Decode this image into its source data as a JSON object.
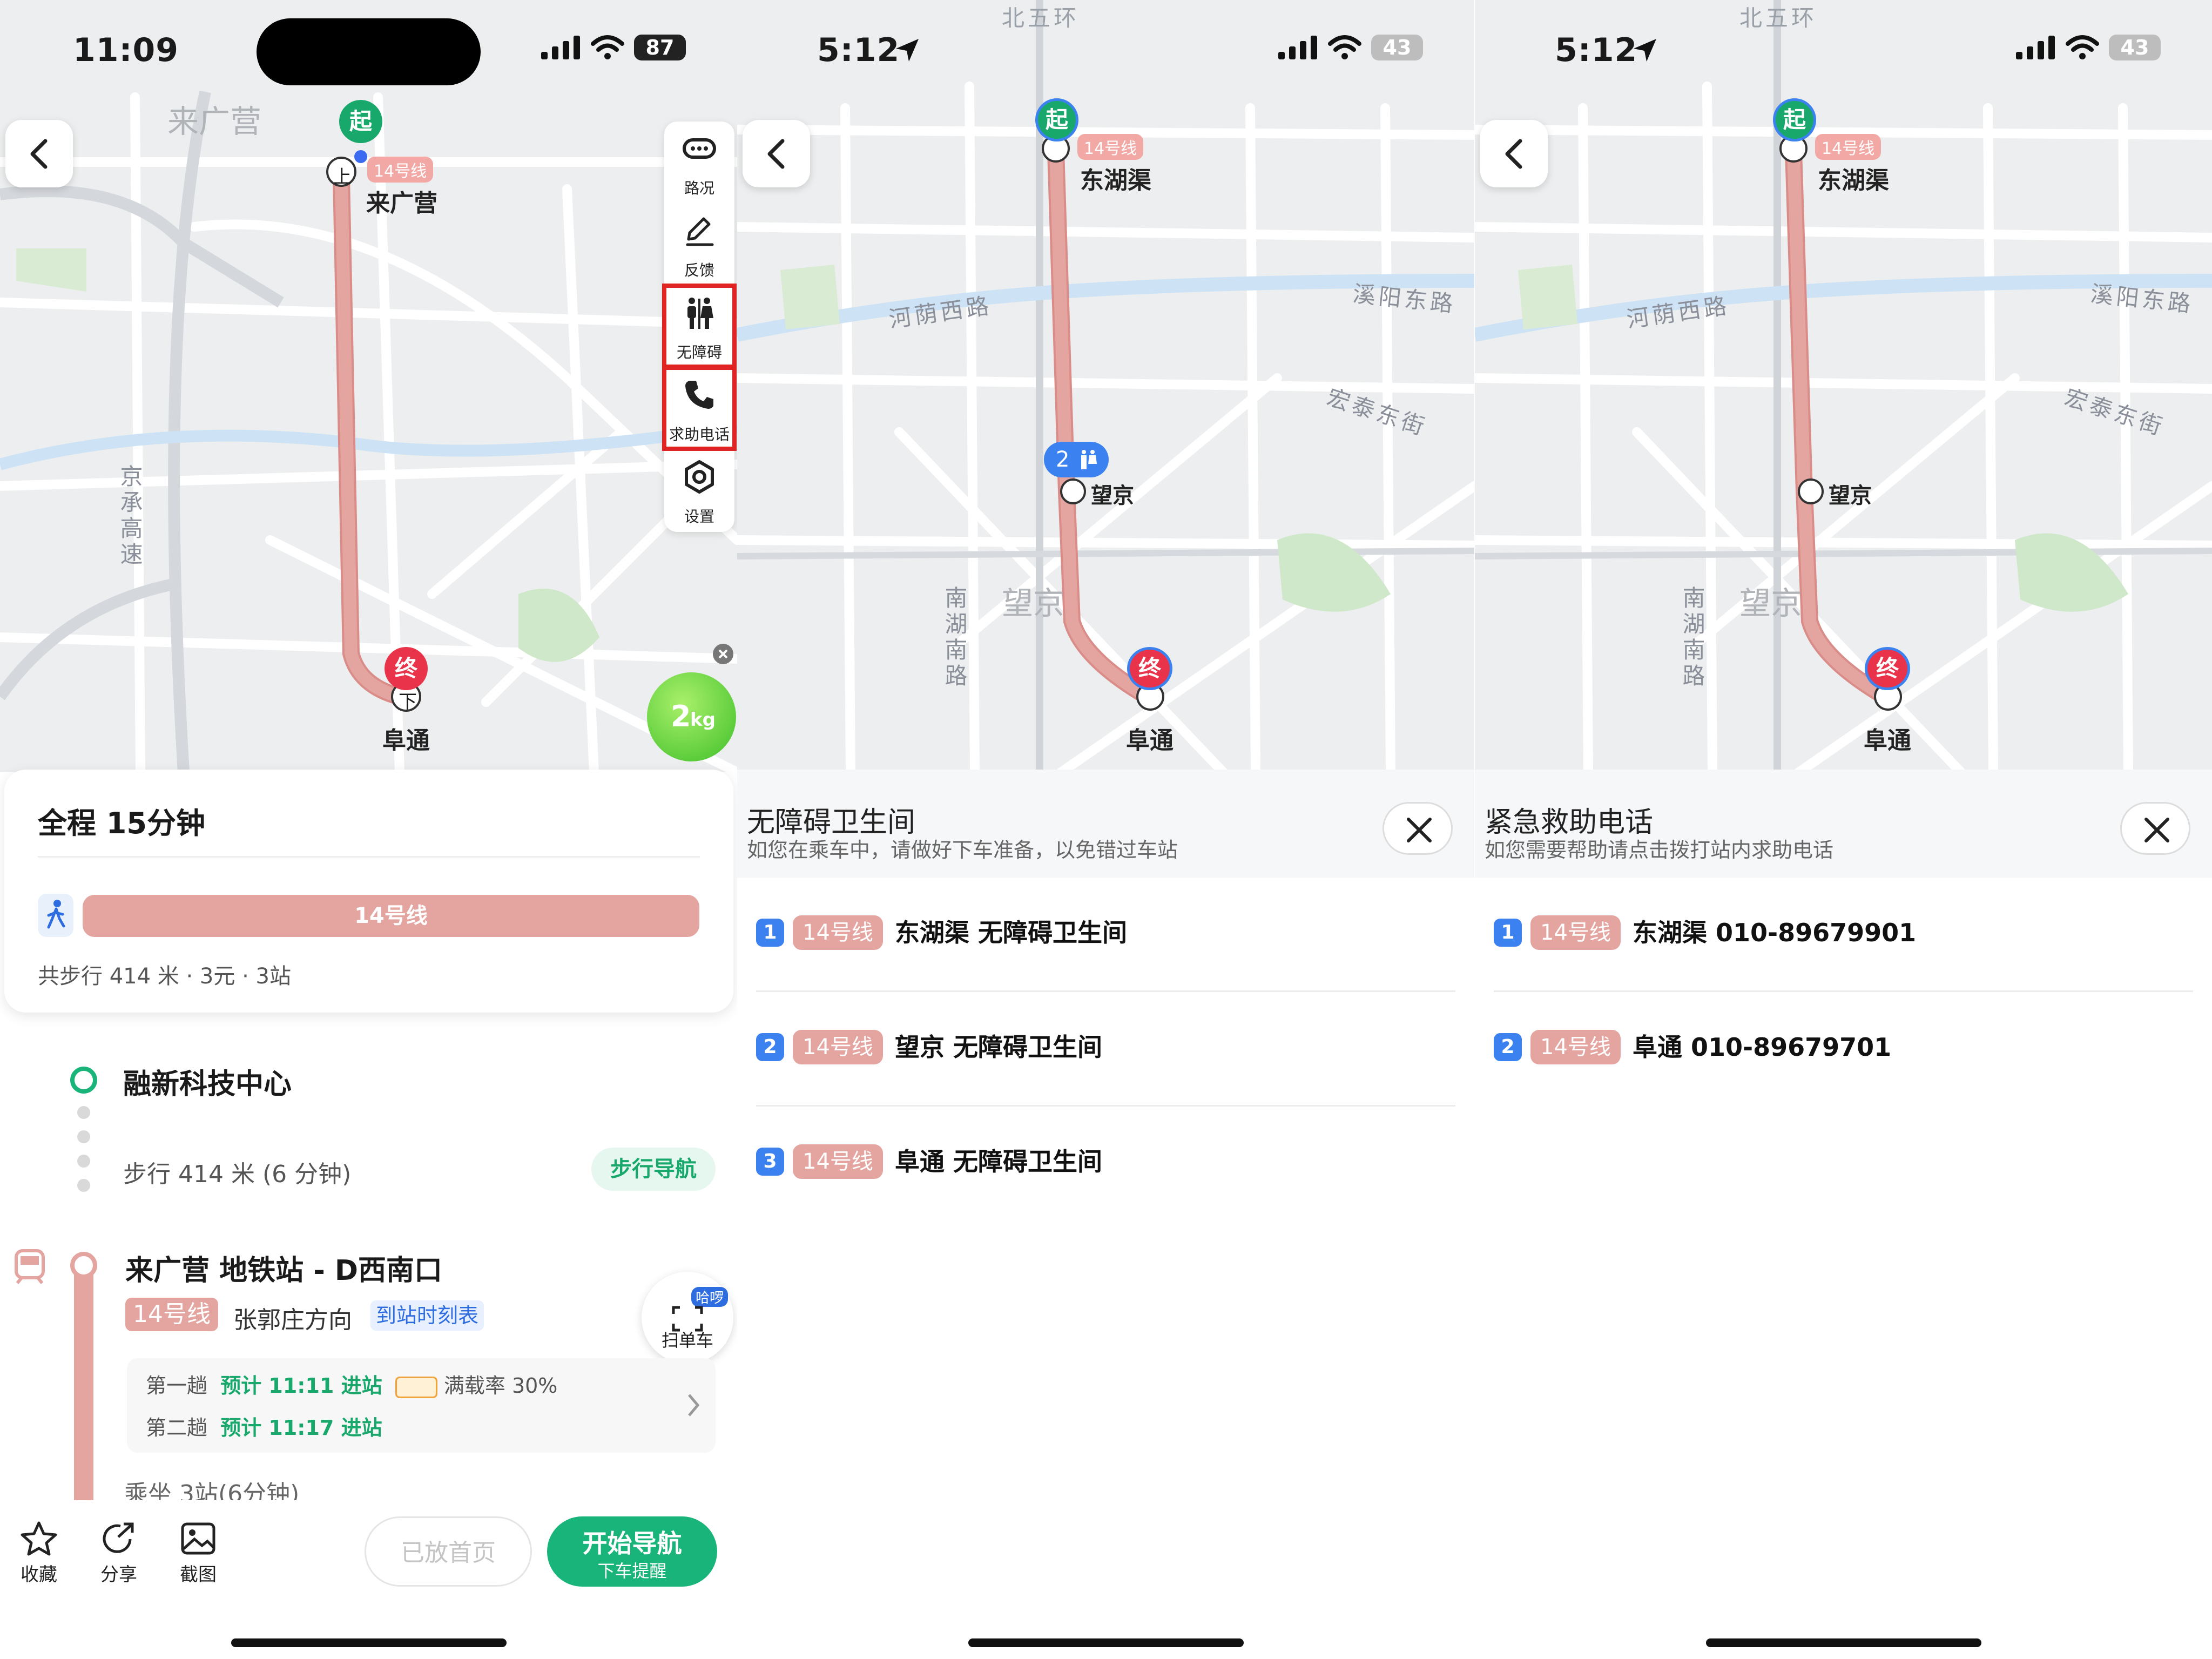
{
  "screen1": {
    "status": {
      "time": "11:09",
      "battery": "87"
    },
    "map": {
      "area_label": "来广营",
      "start_marker": "起",
      "end_marker": "终",
      "board_marker": "上",
      "alight_marker": "下",
      "line_chip": "14号线",
      "start_station": "来广营",
      "end_station": "阜通",
      "road_label": "京承高速"
    },
    "tools": [
      {
        "label": "路况",
        "icon": "traffic-icon"
      },
      {
        "label": "反馈",
        "icon": "feedback-pen-icon"
      },
      {
        "label": "无障碍",
        "icon": "accessibility-icon"
      },
      {
        "label": "求助电话",
        "icon": "phone-icon"
      },
      {
        "label": "设置",
        "icon": "settings-icon"
      }
    ],
    "carbon": {
      "value": "2",
      "unit": "kg"
    },
    "summary": {
      "title": "全程  15分钟",
      "line_bar": "14号线",
      "meta": "共步行 414 米 · 3元 · 3站"
    },
    "steps": {
      "origin": "融新科技中心",
      "walk": "步行 414 米 (6 分钟)",
      "walk_nav": "步行导航",
      "station": "来广营 地铁站 - D西南口",
      "line_tag": "14号线",
      "direction": "张郭庄方向",
      "timetable": "到站时刻表",
      "scan_badge": "哈啰",
      "scan_label": "扫单车",
      "first_label": "第一趟",
      "first_eta": "预计 11:11 进站",
      "load": "满载率 30%",
      "second_label": "第二趟",
      "second_eta": "预计 11:17 进站",
      "ride": "乘坐 3站(6分钟)"
    },
    "bottom": {
      "favorite": "收藏",
      "share": "分享",
      "screenshot": "截图",
      "home_btn": "已放首页",
      "start_nav": "开始导航",
      "start_nav_sub": "下车提醒"
    }
  },
  "screen2": {
    "status": {
      "time": "5:12",
      "battery": "43"
    },
    "map": {
      "top_road": "北五环",
      "line_chip": "14号线",
      "start_station": "东湖渠",
      "mid_station": "望京",
      "end_station": "阜通",
      "road1": "河荫西路",
      "road2": "溪阳东路",
      "road3": "宏泰东街",
      "road4": "南湖南路",
      "area": "望京",
      "start_marker": "起",
      "end_marker": "终",
      "mid_count": "2"
    },
    "sheet": {
      "title": "无障碍卫生间",
      "subtitle": "如您在乘车中，请做好下车准备，以免错过车站",
      "items": [
        {
          "num": "1",
          "line": "14号线",
          "text": "东湖渠 无障碍卫生间"
        },
        {
          "num": "2",
          "line": "14号线",
          "text": "望京 无障碍卫生间"
        },
        {
          "num": "3",
          "line": "14号线",
          "text": "阜通 无障碍卫生间"
        }
      ]
    }
  },
  "screen3": {
    "status": {
      "time": "5:12",
      "battery": "43"
    },
    "map": {
      "top_road": "北五环",
      "line_chip": "14号线",
      "start_station": "东湖渠",
      "mid_station": "望京",
      "end_station": "阜通",
      "road1": "河荫西路",
      "road2": "溪阳东路",
      "road3": "宏泰东街",
      "road4": "南湖南路",
      "area": "望京",
      "start_marker": "起",
      "end_marker": "终"
    },
    "sheet": {
      "title": "紧急救助电话",
      "subtitle": "如您需要帮助请点击拨打站内求助电话",
      "items": [
        {
          "num": "1",
          "line": "14号线",
          "text": "东湖渠 010-89679901"
        },
        {
          "num": "2",
          "line": "14号线",
          "text": "阜通 010-89679701"
        }
      ]
    }
  },
  "colors": {
    "accent_green": "#19b47a",
    "metro_line": "#e4a4a0",
    "end_red": "#e8334a",
    "highlight": "#e02424",
    "badge_blue": "#3b82f0"
  }
}
